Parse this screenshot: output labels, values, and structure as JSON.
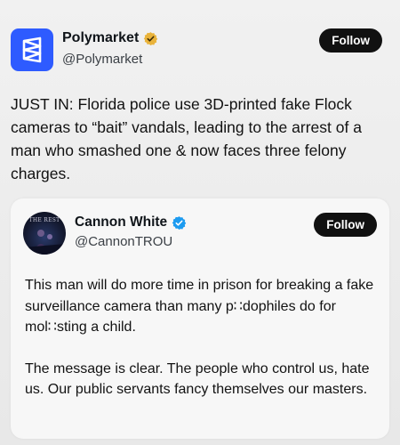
{
  "outer_tweet": {
    "name": "Polymarket",
    "handle": "@Polymarket",
    "follow_label": "Follow",
    "text": "JUST IN: Florida police use 3D-printed fake Flock cameras to “bait” vandals, leading to the arrest of a man who smashed one & now faces three felony charges.",
    "colors": {
      "avatar": "#2e5bff",
      "badge": "#e9b33b"
    }
  },
  "quoted_tweet": {
    "name": "Cannon White",
    "handle": "@CannonTROU",
    "follow_label": "Follow",
    "avatar_text": "THE REST",
    "paragraph_1": "This man will do more time in prison for breaking a fake surveillance camera than many p∷dophiles do for mol∷sting a child.",
    "paragraph_2": "The message is clear. The people who control us, hate us. Our public servants fancy themselves our masters.",
    "colors": {
      "badge": "#1d9bf0"
    }
  }
}
